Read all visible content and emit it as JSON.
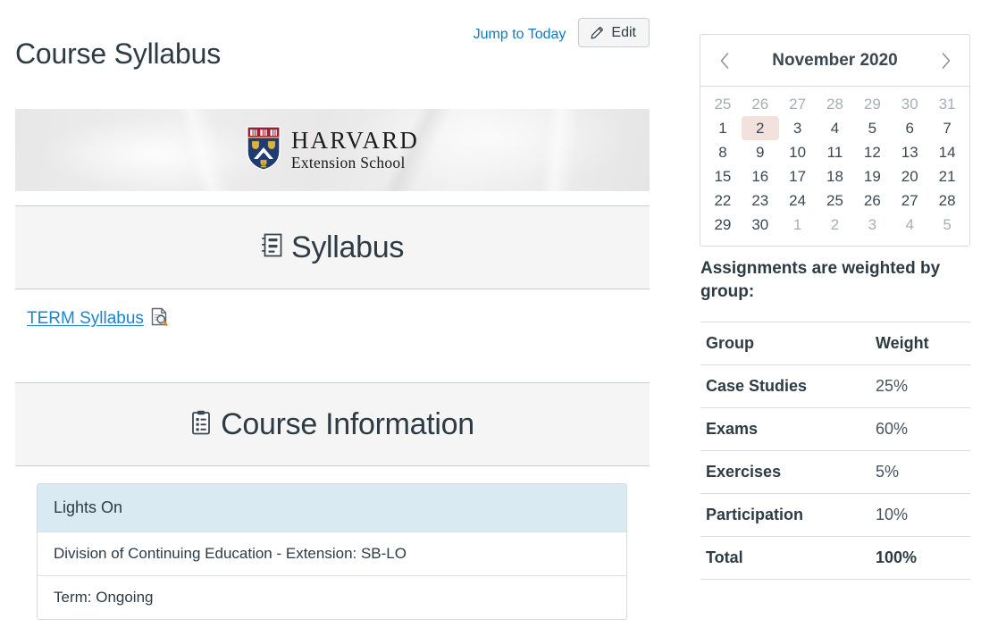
{
  "header": {
    "title": "Course Syllabus",
    "jump_to_today": "Jump to Today",
    "edit_label": "Edit",
    "edit_icon": "pencil-icon"
  },
  "banner": {
    "logo_primary": "HARVARD",
    "logo_secondary": "Extension School",
    "shield_icon": "harvard-shield-icon"
  },
  "sections": {
    "syllabus": {
      "title": "Syllabus",
      "icon": "notebook-document-icon",
      "link_label": "TERM Syllabus",
      "link_icon": "document-preview-icon"
    },
    "course_information": {
      "title": "Course Information",
      "icon": "clipboard-icon"
    }
  },
  "info_table": {
    "header": "Lights On",
    "rows": [
      "Division of Continuing Education - Extension: SB-LO",
      "Term: Ongoing"
    ]
  },
  "calendar": {
    "month_label": "November 2020",
    "prev_icon": "chevron-left-icon",
    "next_icon": "chevron-right-icon",
    "today": "2",
    "weeks": [
      [
        {
          "d": "25",
          "other": true
        },
        {
          "d": "26",
          "other": true
        },
        {
          "d": "27",
          "other": true
        },
        {
          "d": "28",
          "other": true
        },
        {
          "d": "29",
          "other": true
        },
        {
          "d": "30",
          "other": true
        },
        {
          "d": "31",
          "other": true
        }
      ],
      [
        {
          "d": "1"
        },
        {
          "d": "2",
          "today": true
        },
        {
          "d": "3"
        },
        {
          "d": "4"
        },
        {
          "d": "5"
        },
        {
          "d": "6"
        },
        {
          "d": "7"
        }
      ],
      [
        {
          "d": "8"
        },
        {
          "d": "9"
        },
        {
          "d": "10"
        },
        {
          "d": "11"
        },
        {
          "d": "12"
        },
        {
          "d": "13"
        },
        {
          "d": "14"
        }
      ],
      [
        {
          "d": "15"
        },
        {
          "d": "16"
        },
        {
          "d": "17"
        },
        {
          "d": "18"
        },
        {
          "d": "19"
        },
        {
          "d": "20"
        },
        {
          "d": "21"
        }
      ],
      [
        {
          "d": "22"
        },
        {
          "d": "23"
        },
        {
          "d": "24"
        },
        {
          "d": "25"
        },
        {
          "d": "26"
        },
        {
          "d": "27"
        },
        {
          "d": "28"
        }
      ],
      [
        {
          "d": "29"
        },
        {
          "d": "30"
        },
        {
          "d": "1",
          "other": true
        },
        {
          "d": "2",
          "other": true
        },
        {
          "d": "3",
          "other": true
        },
        {
          "d": "4",
          "other": true
        },
        {
          "d": "5",
          "other": true
        }
      ]
    ]
  },
  "weights": {
    "intro": "Assignments are weighted by group:",
    "columns": [
      "Group",
      "Weight"
    ],
    "rows": [
      {
        "group": "Case Studies",
        "weight": "25%"
      },
      {
        "group": "Exams",
        "weight": "60%"
      },
      {
        "group": "Exercises",
        "weight": "5%"
      },
      {
        "group": "Participation",
        "weight": "10%"
      }
    ],
    "total": {
      "group": "Total",
      "weight": "100%"
    }
  },
  "colors": {
    "link_blue": "#0a7ccb",
    "term_link_blue": "#1686d8",
    "text": "#2d3b45",
    "section_bg": "#f5f5f5",
    "table_header_blue": "#d9eaf3",
    "today_highlight": "#f2e1dc",
    "border": "#d7dade"
  }
}
